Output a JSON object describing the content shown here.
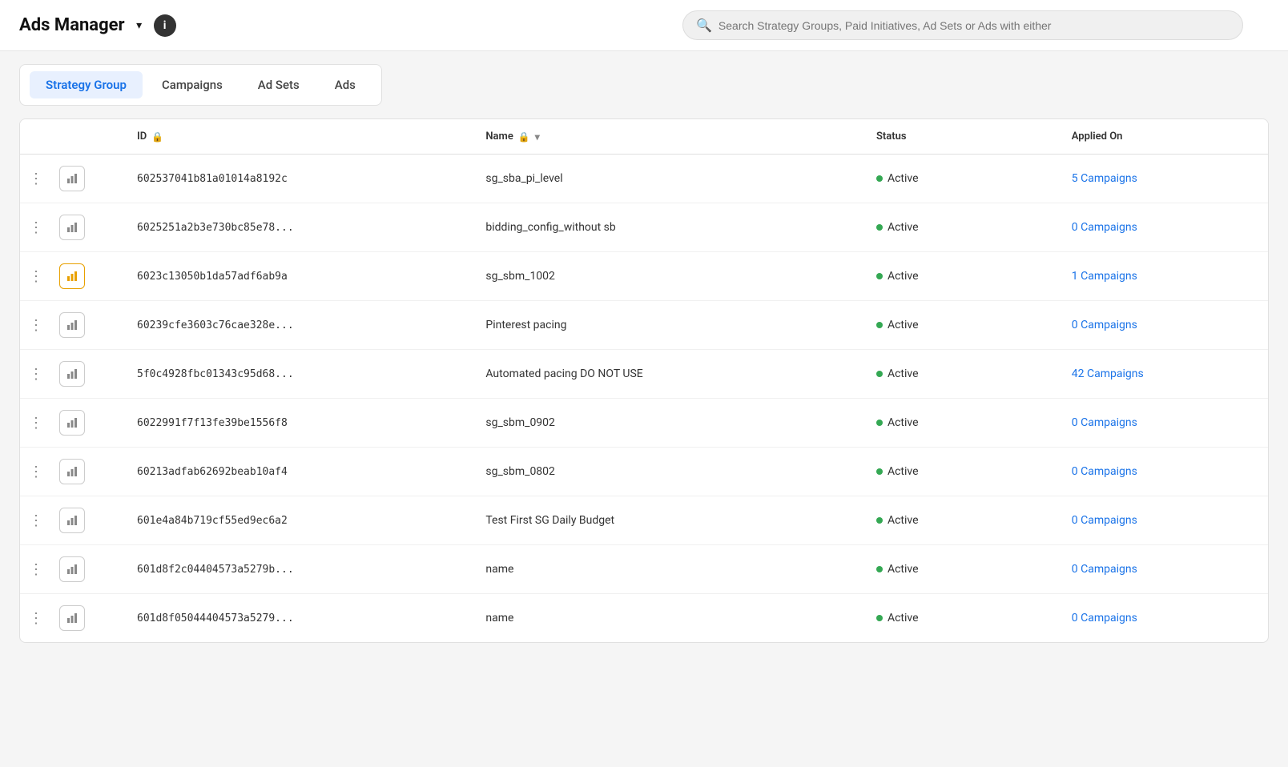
{
  "header": {
    "title": "Ads Manager",
    "info_icon": "i",
    "search_placeholder": "Search Strategy Groups, Paid Initiatives, Ad Sets or Ads with either"
  },
  "tabs": {
    "items": [
      {
        "label": "Strategy Group",
        "active": true
      },
      {
        "label": "Campaigns",
        "active": false
      },
      {
        "label": "Ad Sets",
        "active": false
      },
      {
        "label": "Ads",
        "active": false
      }
    ]
  },
  "table": {
    "columns": [
      {
        "label": "",
        "key": "actions"
      },
      {
        "label": "",
        "key": "chart"
      },
      {
        "label": "",
        "key": "checkbox"
      },
      {
        "label": "ID",
        "key": "id",
        "has_lock": true
      },
      {
        "label": "Name",
        "key": "name",
        "has_lock": true,
        "has_sort": true
      },
      {
        "label": "Status",
        "key": "status"
      },
      {
        "label": "Applied On",
        "key": "applied_on"
      }
    ],
    "rows": [
      {
        "id": "602537041b81a01014a8192c",
        "name": "sg_sba_pi_level",
        "status": "Active",
        "applied_on": "5 Campaigns",
        "highlighted": false
      },
      {
        "id": "6025251a2b3e730bc85e78...",
        "name": "bidding_config_without sb",
        "status": "Active",
        "applied_on": "0 Campaigns",
        "highlighted": false
      },
      {
        "id": "6023c13050b1da57adf6ab9a",
        "name": "sg_sbm_1002",
        "status": "Active",
        "applied_on": "1 Campaigns",
        "highlighted": true
      },
      {
        "id": "60239cfe3603c76cae328e...",
        "name": "Pinterest pacing",
        "status": "Active",
        "applied_on": "0 Campaigns",
        "highlighted": false
      },
      {
        "id": "5f0c4928fbc01343c95d68...",
        "name": "Automated pacing DO NOT USE",
        "status": "Active",
        "applied_on": "42 Campaigns",
        "highlighted": false
      },
      {
        "id": "6022991f7f13fe39be1556f8",
        "name": "sg_sbm_0902",
        "status": "Active",
        "applied_on": "0 Campaigns",
        "highlighted": false
      },
      {
        "id": "60213adfab62692beab10af4",
        "name": "sg_sbm_0802",
        "status": "Active",
        "applied_on": "0 Campaigns",
        "highlighted": false
      },
      {
        "id": "601e4a84b719cf55ed9ec6a2",
        "name": "Test First SG Daily Budget",
        "status": "Active",
        "applied_on": "0 Campaigns",
        "highlighted": false
      },
      {
        "id": "601d8f2c04404573a5279b...",
        "name": "name",
        "status": "Active",
        "applied_on": "0 Campaigns",
        "highlighted": false
      },
      {
        "id": "601d8f05044404573a5279...",
        "name": "name",
        "status": "Active",
        "applied_on": "0 Campaigns",
        "highlighted": false
      }
    ]
  },
  "icons": {
    "chevron": "▾",
    "info": "i",
    "search": "🔍",
    "dots": "⋮",
    "chart": "📊",
    "lock": "🔒",
    "sort_down": "▾"
  },
  "colors": {
    "active_tab_bg": "#e8f0fe",
    "active_tab_text": "#1a73e8",
    "status_dot": "#34a853",
    "link": "#1a73e8",
    "highlight_border": "#e8a000"
  }
}
